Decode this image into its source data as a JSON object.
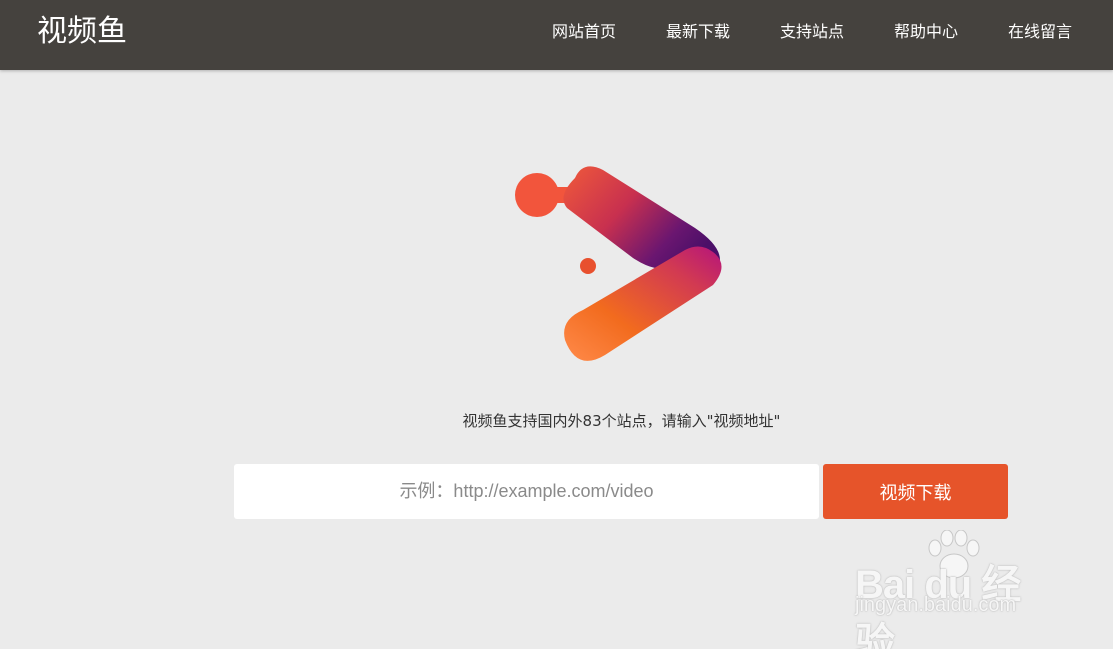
{
  "header": {
    "brand": "视频鱼",
    "nav": [
      {
        "label": "网站首页"
      },
      {
        "label": "最新下载"
      },
      {
        "label": "支持站点"
      },
      {
        "label": "帮助中心"
      },
      {
        "label": "在线留言"
      }
    ]
  },
  "main": {
    "tagline": "视频鱼支持国内外83个站点，请输入\"视频地址\"",
    "search": {
      "value": "",
      "placeholder": "示例：http://example.com/video"
    },
    "download_label": "视频下载"
  },
  "watermark": {
    "brand": "Bai  du 经验",
    "sub": "jingyan.baidu.com"
  },
  "colors": {
    "header_bg": "#45423e",
    "page_bg": "#ebebeb",
    "accent": "#e6542a"
  }
}
